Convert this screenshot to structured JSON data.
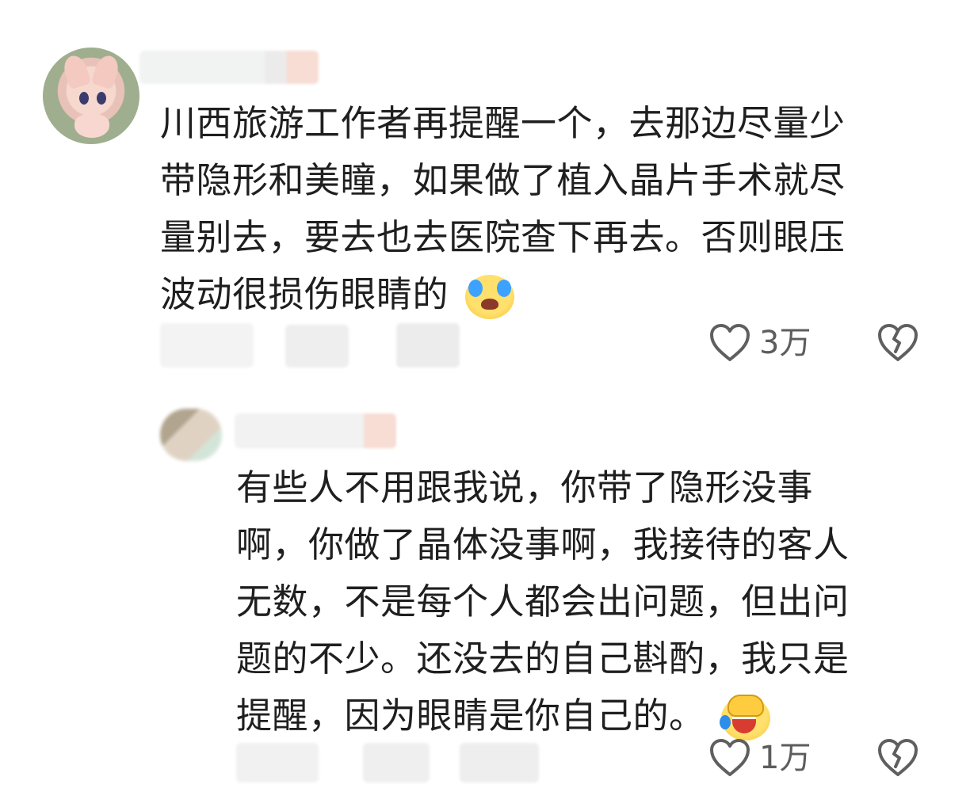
{
  "comments": [
    {
      "lines": [
        "川西旅游工作者再提醒一个，去那边尽量少",
        "带隐形和美瞳，如果做了植入晶片手术就尽",
        "量别去，要去也去医院查下再去。否则眼压",
        "波动很损伤眼睛的"
      ],
      "emoji_icon": "crying-tears-emoji-icon",
      "likes": "3万"
    },
    {
      "lines": [
        "有些人不用跟我说，你带了隐形没事",
        "啊，你做了晶体没事啊，我接待的客人",
        "无数，不是每个人都会出问题，但出问",
        "题的不少。还没去的自己斟酌，我只是",
        "提醒，因为眼睛是你自己的。"
      ],
      "emoji_icon": "facepalm-laughing-emoji-icon",
      "likes": "1万"
    }
  ],
  "icons": {
    "like": "heart-outline-icon",
    "dislike": "broken-heart-icon"
  },
  "colors": {
    "text": "#1f1f1f",
    "icon": "#5f5f5f",
    "background": "#ffffff"
  }
}
